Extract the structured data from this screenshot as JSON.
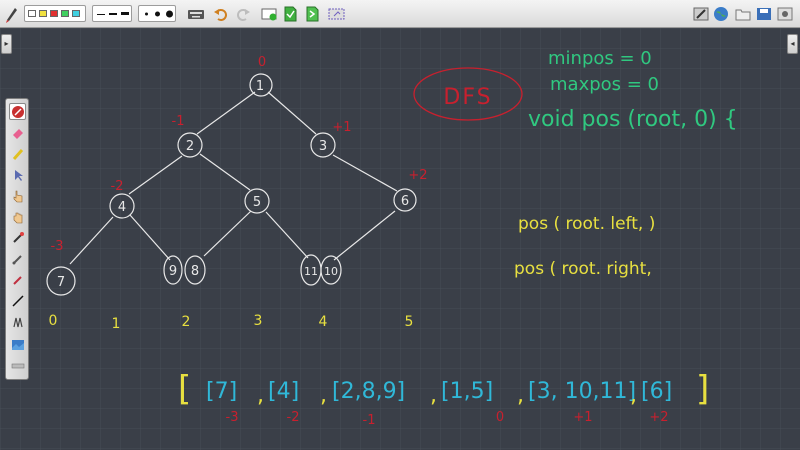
{
  "toolbar": {
    "swatches": [
      "#ffffff",
      "#f0e040",
      "#e03030",
      "#40d060",
      "#40d0e0"
    ],
    "line_widths": [
      "thin-line",
      "medium-line",
      "thick-line"
    ],
    "dot_sizes": [
      "small-dot",
      "medium-dot",
      "large-dot"
    ],
    "icons_left": [
      "keyboard-icon",
      "undo-icon",
      "redo-icon",
      "new-page-icon",
      "page-green-icon",
      "page-export-icon",
      "screen-capture-icon"
    ],
    "icons_right": [
      "draw-mode-icon",
      "web-icon",
      "folder-icon",
      "save-icon",
      "display-icon",
      "settings-icon"
    ]
  },
  "tools": [
    "pen-tool-icon",
    "eraser-icon",
    "highlighter-icon",
    "selector-icon",
    "hand-pointer-icon",
    "grab-hand-icon",
    "laser-pointer-icon",
    "text-tool-icon",
    "marker-icon",
    "line-tool-icon",
    "shapes-icon",
    "image-icon",
    "ruler-icon"
  ],
  "board": {
    "colors": {
      "white": "#e8e8e8",
      "red": "#c8202e",
      "yellow": "#e8e040",
      "green": "#30c880",
      "cyan": "#30b8d8"
    },
    "tree_nodes": [
      {
        "id": "node-1",
        "label": "1"
      },
      {
        "id": "node-2",
        "label": "2"
      },
      {
        "id": "node-3",
        "label": "3"
      },
      {
        "id": "node-4",
        "label": "4"
      },
      {
        "id": "node-5",
        "label": "5"
      },
      {
        "id": "node-6",
        "label": "6"
      },
      {
        "id": "node-7",
        "label": "7"
      },
      {
        "id": "node-9",
        "label": "9"
      },
      {
        "id": "node-8",
        "label": "8"
      },
      {
        "id": "node-11",
        "label": "11"
      },
      {
        "id": "node-10",
        "label": "10"
      }
    ],
    "position_labels": [
      "0",
      "-1",
      "+1",
      "-2",
      "+2",
      "-3"
    ],
    "column_indices": [
      "0",
      "1",
      "2",
      "3",
      "4",
      "5"
    ],
    "dfs_label": "DFS",
    "code_lines": [
      "minpos = 0",
      "maxpos = 0",
      "void pos (root, 0) {"
    ],
    "recursion_lines": [
      "pos ( root. left,      )",
      "pos ( root. right,"
    ],
    "result_open": "[",
    "result_groups": [
      "[7]",
      "[4]",
      "[2,8,9]",
      "[1,5]",
      "[3, 10,11]",
      "[6]"
    ],
    "result_close": "]",
    "result_separators": [
      ",",
      ",",
      ",",
      ",",
      ","
    ],
    "under_labels": [
      "-3",
      "-2",
      "-1",
      "0",
      "+1",
      "+2"
    ]
  }
}
